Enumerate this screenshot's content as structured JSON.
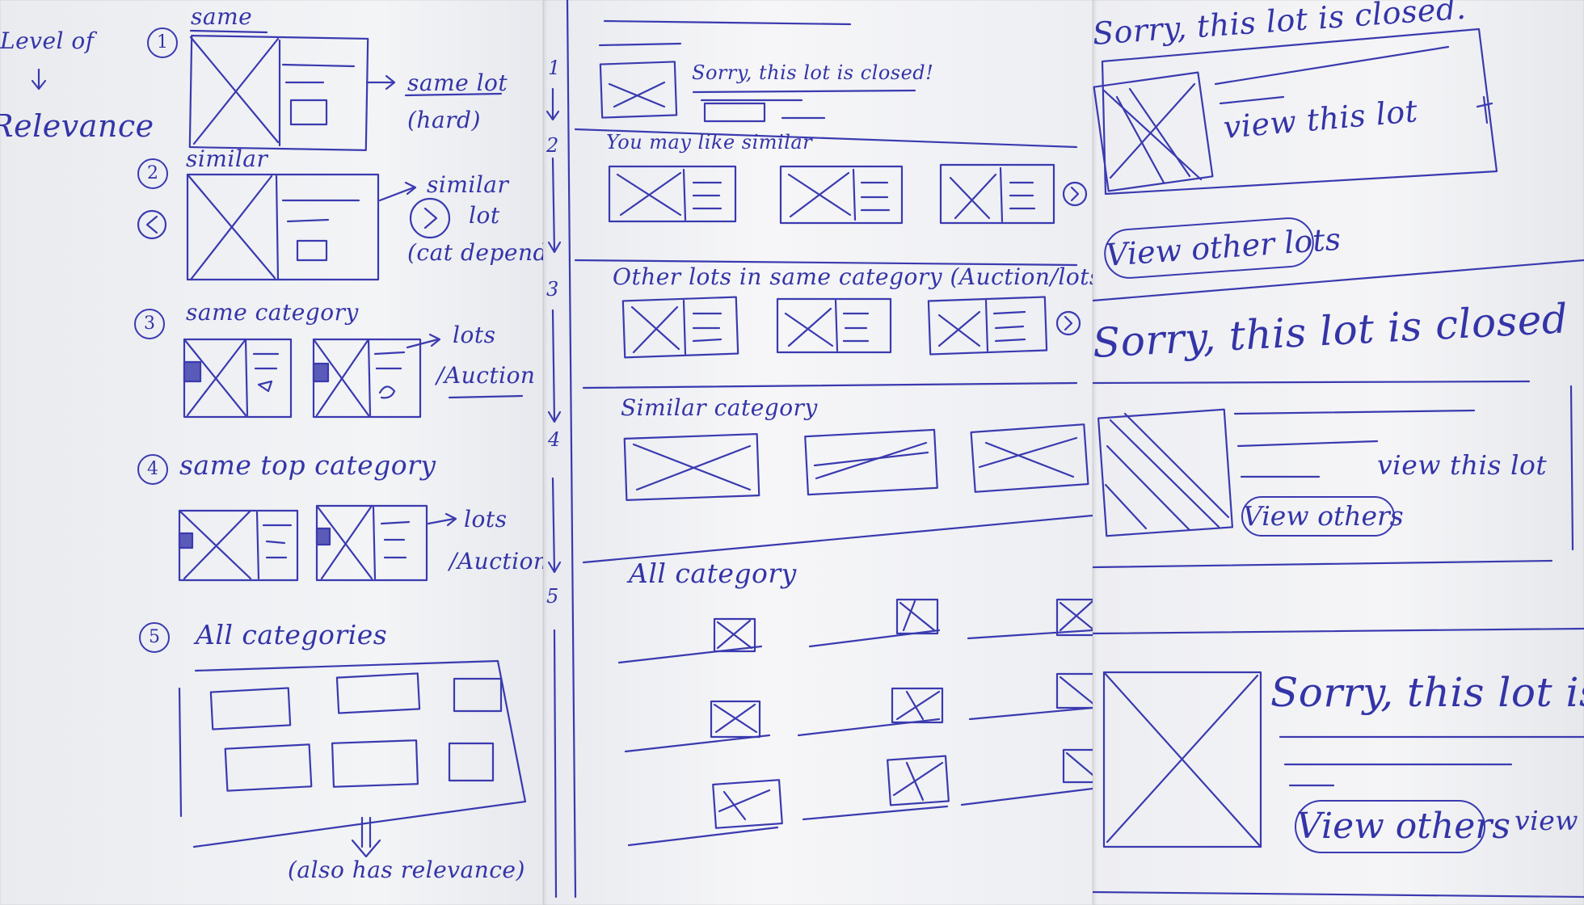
{
  "left_page": {
    "header_line1": "Level of",
    "header_line2": "Relevance",
    "levels": [
      {
        "number": "1",
        "title": "same",
        "note_line1": "same lot",
        "note_line2": "(hard)"
      },
      {
        "number": "2",
        "title": "similar",
        "note_line1": "similar",
        "note_line2": "lot",
        "note_line3": "(cat depends)"
      },
      {
        "number": "3",
        "title": "same category",
        "note_line1": "lots",
        "note_line2": "/Auction"
      },
      {
        "number": "4",
        "title": "same top category",
        "note_line1": "lots",
        "note_line2": "/Auction"
      },
      {
        "number": "5",
        "title": "All categories",
        "note_line1": "(also has relevance)"
      }
    ]
  },
  "middle_page": {
    "markers": [
      "1",
      "2",
      "3",
      "4",
      "5"
    ],
    "closed_notice": "Sorry, this lot is closed!",
    "sections": [
      {
        "title": "You may like similar"
      },
      {
        "title": "Other lots in same category (Auction/lots)"
      },
      {
        "title": "Similar category"
      },
      {
        "title": "All category"
      }
    ]
  },
  "right_page": {
    "variants": [
      {
        "heading": "Sorry, this lot is closed.",
        "link": "view this lot",
        "button": "View other lots"
      },
      {
        "heading": "Sorry, this lot is closed",
        "link": "view this lot",
        "button": "View others"
      },
      {
        "heading": "Sorry, this lot is cl",
        "link": "view t",
        "button": "View others"
      }
    ]
  },
  "colors": {
    "ink": "#3434a8",
    "paper": "#f3f4f6"
  }
}
